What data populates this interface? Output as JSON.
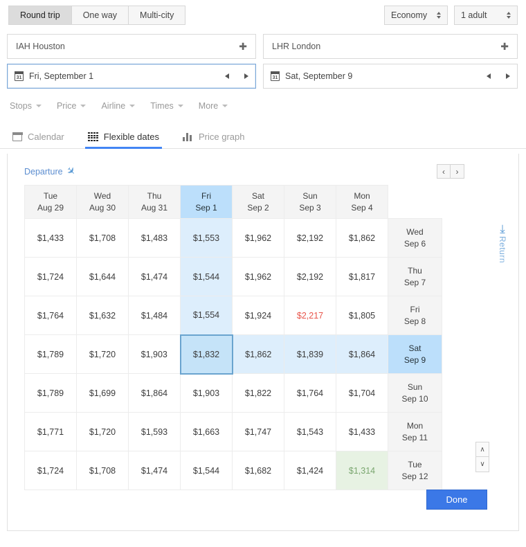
{
  "trip": {
    "options": [
      {
        "label": "Round trip",
        "active": true
      },
      {
        "label": "One way",
        "active": false
      },
      {
        "label": "Multi-city",
        "active": false
      }
    ],
    "cabin": "Economy",
    "passengers": "1 adult"
  },
  "route": {
    "origin": "IAH Houston",
    "destination": "LHR London",
    "add_icon": "plus-icon"
  },
  "dates": {
    "depart": "Fri, September 1",
    "return": "Sat, September 9",
    "calendar_icon_day": "31"
  },
  "filters": [
    {
      "label": "Stops"
    },
    {
      "label": "Price"
    },
    {
      "label": "Airline"
    },
    {
      "label": "Times"
    },
    {
      "label": "More"
    }
  ],
  "tabs": [
    {
      "label": "Calendar",
      "icon": "calendar-icon",
      "active": false
    },
    {
      "label": "Flexible dates",
      "icon": "grid-icon",
      "active": true
    },
    {
      "label": "Price graph",
      "icon": "bar-chart-icon",
      "active": false
    }
  ],
  "panel": {
    "departure_label": "Departure",
    "return_label": "Return",
    "prev_label": "‹",
    "next_label": "›",
    "scroll_up": "∧",
    "scroll_down": "∨",
    "done_label": "Done"
  },
  "colors": {
    "accent_blue": "#4285f4",
    "selected_header": "#bcdffb",
    "selected_cell": "#c5e3f8",
    "highlight_row": "#ddeefc",
    "cheapest_green": "#7aa66f",
    "expensive_red": "#e8544a",
    "done_button": "#3b78e7"
  },
  "chart_data": {
    "type": "table",
    "title": "Flexible dates price matrix",
    "xlabel": "Departure",
    "ylabel": "Return",
    "categories": [
      "Tue Aug 29",
      "Wed Aug 30",
      "Thu Aug 31",
      "Fri Sep 1",
      "Sat Sep 2",
      "Sun Sep 3",
      "Mon Sep 4"
    ],
    "row_categories": [
      "Wed Sep 6",
      "Thu Sep 7",
      "Fri Sep 8",
      "Sat Sep 9",
      "Sun Sep 10",
      "Mon Sep 11",
      "Tue Sep 12"
    ],
    "selected_departure": "Fri Sep 1",
    "selected_return": "Sat Sep 9",
    "selected_price": "$1,832",
    "cheapest_price": "$1,314",
    "most_expensive_price": "$2,217",
    "columns": [
      {
        "day": "Tue",
        "date": "Aug 29",
        "selected": false
      },
      {
        "day": "Wed",
        "date": "Aug 30",
        "selected": false
      },
      {
        "day": "Thu",
        "date": "Aug 31",
        "selected": false
      },
      {
        "day": "Fri",
        "date": "Sep 1",
        "selected": true
      },
      {
        "day": "Sat",
        "date": "Sep 2",
        "selected": false
      },
      {
        "day": "Sun",
        "date": "Sep 3",
        "selected": false
      },
      {
        "day": "Mon",
        "date": "Sep 4",
        "selected": false
      }
    ],
    "rows": [
      {
        "day": "Wed",
        "date": "Sep 6",
        "selected": false,
        "prices": [
          {
            "v": "$1,433"
          },
          {
            "v": "$1,708"
          },
          {
            "v": "$1,483"
          },
          {
            "v": "$1,553",
            "colsel": true
          },
          {
            "v": "$1,962"
          },
          {
            "v": "$2,192"
          },
          {
            "v": "$1,862"
          }
        ]
      },
      {
        "day": "Thu",
        "date": "Sep 7",
        "selected": false,
        "prices": [
          {
            "v": "$1,724"
          },
          {
            "v": "$1,644"
          },
          {
            "v": "$1,474"
          },
          {
            "v": "$1,544",
            "colsel": true
          },
          {
            "v": "$1,962"
          },
          {
            "v": "$2,192"
          },
          {
            "v": "$1,817"
          }
        ]
      },
      {
        "day": "Fri",
        "date": "Sep 8",
        "selected": false,
        "prices": [
          {
            "v": "$1,764"
          },
          {
            "v": "$1,632"
          },
          {
            "v": "$1,484"
          },
          {
            "v": "$1,554",
            "colsel": true
          },
          {
            "v": "$1,924"
          },
          {
            "v": "$2,217",
            "high": true
          },
          {
            "v": "$1,805"
          }
        ]
      },
      {
        "day": "Sat",
        "date": "Sep 9",
        "selected": true,
        "prices": [
          {
            "v": "$1,789"
          },
          {
            "v": "$1,720"
          },
          {
            "v": "$1,903"
          },
          {
            "v": "$1,832",
            "cellsel": true
          },
          {
            "v": "$1,862",
            "rowsel": true
          },
          {
            "v": "$1,839",
            "rowsel": true
          },
          {
            "v": "$1,864",
            "rowsel": true
          }
        ]
      },
      {
        "day": "Sun",
        "date": "Sep 10",
        "selected": false,
        "prices": [
          {
            "v": "$1,789"
          },
          {
            "v": "$1,699"
          },
          {
            "v": "$1,864"
          },
          {
            "v": "$1,903"
          },
          {
            "v": "$1,822"
          },
          {
            "v": "$1,764"
          },
          {
            "v": "$1,704"
          }
        ]
      },
      {
        "day": "Mon",
        "date": "Sep 11",
        "selected": false,
        "prices": [
          {
            "v": "$1,771"
          },
          {
            "v": "$1,720"
          },
          {
            "v": "$1,593"
          },
          {
            "v": "$1,663"
          },
          {
            "v": "$1,747"
          },
          {
            "v": "$1,543"
          },
          {
            "v": "$1,433"
          }
        ]
      },
      {
        "day": "Tue",
        "date": "Sep 12",
        "selected": false,
        "prices": [
          {
            "v": "$1,724"
          },
          {
            "v": "$1,708"
          },
          {
            "v": "$1,474"
          },
          {
            "v": "$1,544"
          },
          {
            "v": "$1,682"
          },
          {
            "v": "$1,424"
          },
          {
            "v": "$1,314",
            "cheap": true
          }
        ]
      }
    ]
  }
}
